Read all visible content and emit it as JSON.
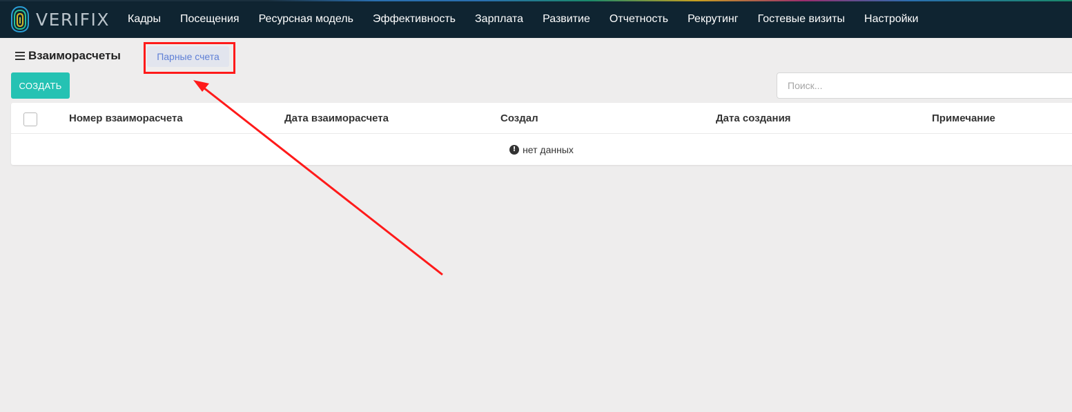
{
  "app": {
    "logo_text": "VERIFIX"
  },
  "nav": {
    "items": [
      {
        "label": "Кадры"
      },
      {
        "label": "Посещения"
      },
      {
        "label": "Ресурсная модель"
      },
      {
        "label": "Эффективность"
      },
      {
        "label": "Зарплата"
      },
      {
        "label": "Развитие"
      },
      {
        "label": "Отчетность"
      },
      {
        "label": "Рекрутинг"
      },
      {
        "label": "Гостевые визиты"
      },
      {
        "label": "Настройки"
      }
    ]
  },
  "page": {
    "title": "Взаиморасчеты",
    "tab_label": "Парные счета",
    "create_label": "СОЗДАТЬ",
    "search_placeholder": "Поиск..."
  },
  "table": {
    "columns": [
      {
        "label": "Номер взаиморасчета"
      },
      {
        "label": "Дата взаиморасчета"
      },
      {
        "label": "Создал"
      },
      {
        "label": "Дата создания"
      },
      {
        "label": "Примечание"
      }
    ],
    "empty_text": "нет данных"
  },
  "colors": {
    "accent": "#25c2b3",
    "navbar": "#0f2431",
    "annotation": "#ff1a1a",
    "tab_text": "#5e7fd6"
  }
}
